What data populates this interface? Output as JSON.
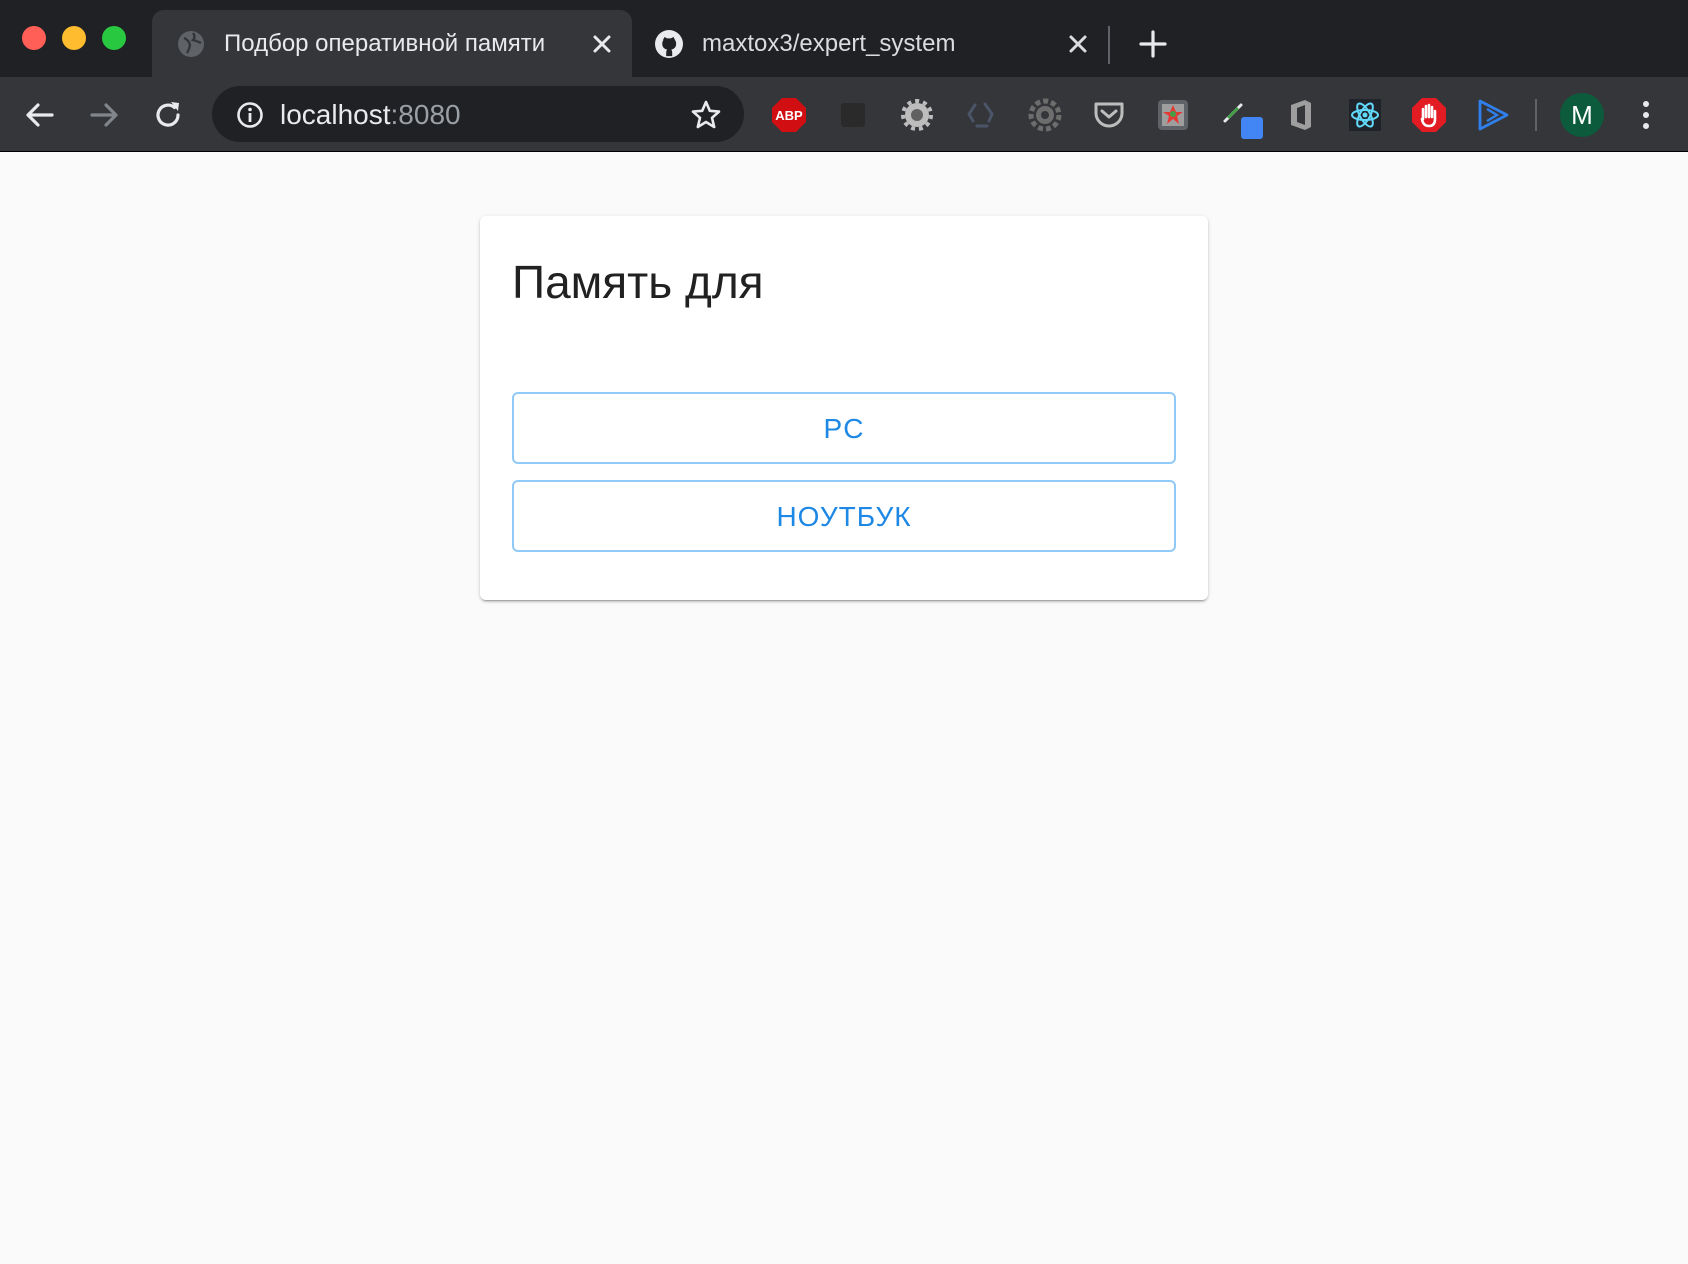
{
  "browser": {
    "tabs": [
      {
        "title": "Подбор оперативной памяти",
        "favicon": "globe-icon",
        "active": true
      },
      {
        "title": "maxtox3/expert_system",
        "favicon": "github-icon",
        "active": false
      }
    ],
    "address": {
      "host": "localhost",
      "port": ":8080"
    },
    "extensions": [
      {
        "name": "abp-icon",
        "label": "ABP"
      },
      {
        "name": "dark-square-extension-icon"
      },
      {
        "name": "gear-extension-icon"
      },
      {
        "name": "recycle-extension-icon"
      },
      {
        "name": "settings-cog-extension-icon"
      },
      {
        "name": "pocket-icon"
      },
      {
        "name": "color-picker-extension-icon"
      },
      {
        "name": "eyedropper-extension-icon"
      },
      {
        "name": "office-icon"
      },
      {
        "name": "react-devtools-icon"
      },
      {
        "name": "stop-hand-icon"
      },
      {
        "name": "play-cast-icon"
      }
    ],
    "profile_initial": "M",
    "colors": {
      "tabstrip": "#202124",
      "toolbar": "#35363a",
      "avatar": "#0b5b3c",
      "abp_red": "#d10f13",
      "react_blue": "#61dafb"
    }
  },
  "card": {
    "title": "Память для",
    "buttons": [
      {
        "label": "PC"
      },
      {
        "label": "НОУТБУК"
      }
    ],
    "accent": "#1e88e5"
  }
}
